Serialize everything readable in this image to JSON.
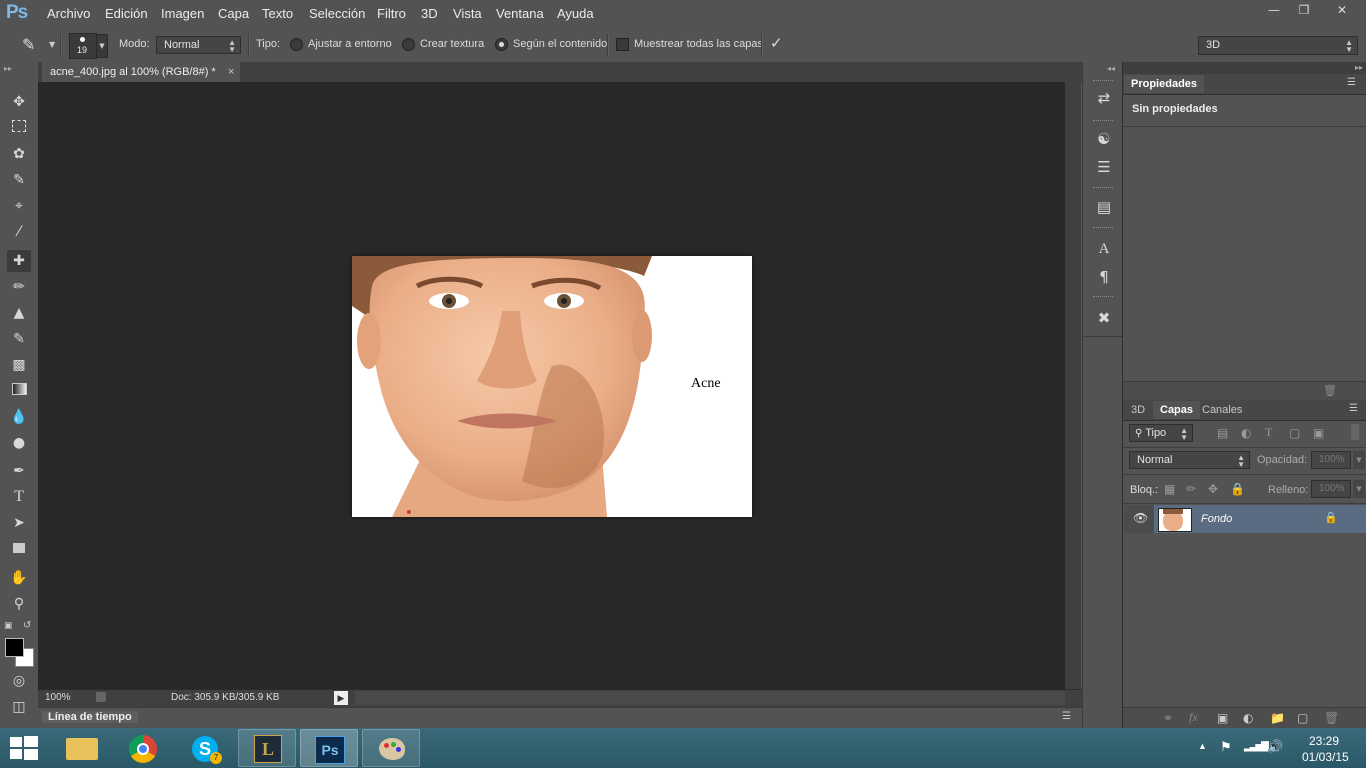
{
  "app": {
    "logo": "Ps"
  },
  "menu": [
    "Archivo",
    "Edición",
    "Imagen",
    "Capa",
    "Texto",
    "Selección",
    "Filtro",
    "3D",
    "Vista",
    "Ventana",
    "Ayuda"
  ],
  "options": {
    "brush_size": "19",
    "mode_label": "Modo:",
    "mode_value": "Normal",
    "type_label": "Tipo:",
    "radio1": "Ajustar a entorno",
    "radio2": "Crear textura",
    "radio3": "Según el contenido",
    "selected_radio": "Según el contenido",
    "sample_all": "Muestrear todas las capas",
    "workspace": "3D"
  },
  "document": {
    "tab_title": "acne_400.jpg al 100% (RGB/8#) *",
    "zoom": "100%",
    "doc_info": "Doc: 305.9 KB/305.9 KB",
    "image_caption": "Acne"
  },
  "timeline": {
    "label": "Línea de tiempo"
  },
  "properties": {
    "tab": "Propiedades",
    "content": "Sin propiedades"
  },
  "layers": {
    "tabs": [
      "3D",
      "Capas",
      "Canales"
    ],
    "active_tab": "Capas",
    "filter": "Tipo",
    "blend_mode": "Normal",
    "opacity_label": "Opacidad:",
    "opacity_value": "100%",
    "lock_label": "Bloq.:",
    "fill_label": "Relleno:",
    "fill_value": "100%",
    "items": [
      {
        "name": "Fondo",
        "visible": true,
        "locked": true
      }
    ]
  },
  "taskbar": {
    "time": "23:29",
    "date": "01/03/15",
    "skype_badge": "7"
  },
  "colors": {
    "canvas_bg": "#282828",
    "panel_bg": "#535353",
    "selected_layer": "#5a6b82"
  }
}
